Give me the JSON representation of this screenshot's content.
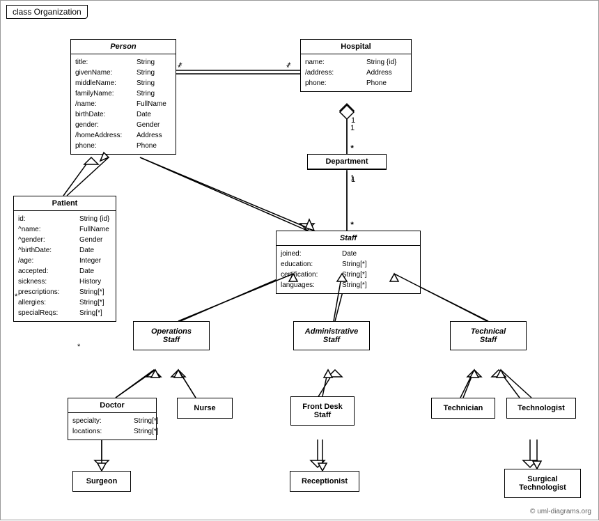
{
  "title": "class Organization",
  "copyright": "© uml-diagrams.org",
  "classes": {
    "person": {
      "name": "Person",
      "italic": true,
      "attrs": [
        [
          "title:",
          "String"
        ],
        [
          "givenName:",
          "String"
        ],
        [
          "middleName:",
          "String"
        ],
        [
          "familyName:",
          "String"
        ],
        [
          "/name:",
          "FullName"
        ],
        [
          "birthDate:",
          "Date"
        ],
        [
          "gender:",
          "Gender"
        ],
        [
          "/homeAddress:",
          "Address"
        ],
        [
          "phone:",
          "Phone"
        ]
      ]
    },
    "hospital": {
      "name": "Hospital",
      "italic": false,
      "attrs": [
        [
          "name:",
          "String {id}"
        ],
        [
          "/address:",
          "Address"
        ],
        [
          "phone:",
          "Phone"
        ]
      ]
    },
    "department": {
      "name": "Department",
      "italic": false,
      "attrs": []
    },
    "staff": {
      "name": "Staff",
      "italic": true,
      "attrs": [
        [
          "joined:",
          "Date"
        ],
        [
          "education:",
          "String[*]"
        ],
        [
          "certification:",
          "String[*]"
        ],
        [
          "languages:",
          "String[*]"
        ]
      ]
    },
    "patient": {
      "name": "Patient",
      "italic": false,
      "attrs": [
        [
          "id:",
          "String {id}"
        ],
        [
          "^name:",
          "FullName"
        ],
        [
          "^gender:",
          "Gender"
        ],
        [
          "^birthDate:",
          "Date"
        ],
        [
          "/age:",
          "Integer"
        ],
        [
          "accepted:",
          "Date"
        ],
        [
          "sickness:",
          "History"
        ],
        [
          "prescriptions:",
          "String[*]"
        ],
        [
          "allergies:",
          "String[*]"
        ],
        [
          "specialReqs:",
          "Sring[*]"
        ]
      ]
    },
    "operations_staff": {
      "name": "Operations\nStaff",
      "italic": true
    },
    "administrative_staff": {
      "name": "Administrative\nStaff",
      "italic": true
    },
    "technical_staff": {
      "name": "Technical\nStaff",
      "italic": true
    },
    "doctor": {
      "name": "Doctor",
      "italic": false,
      "attrs": [
        [
          "specialty:",
          "String[*]"
        ],
        [
          "locations:",
          "String[*]"
        ]
      ]
    },
    "nurse": {
      "name": "Nurse",
      "italic": false
    },
    "front_desk_staff": {
      "name": "Front Desk\nStaff",
      "italic": false
    },
    "technician": {
      "name": "Technician",
      "italic": false
    },
    "technologist": {
      "name": "Technologist",
      "italic": false
    },
    "surgeon": {
      "name": "Surgeon",
      "italic": false
    },
    "receptionist": {
      "name": "Receptionist",
      "italic": false
    },
    "surgical_technologist": {
      "name": "Surgical\nTechnologist",
      "italic": false
    }
  }
}
